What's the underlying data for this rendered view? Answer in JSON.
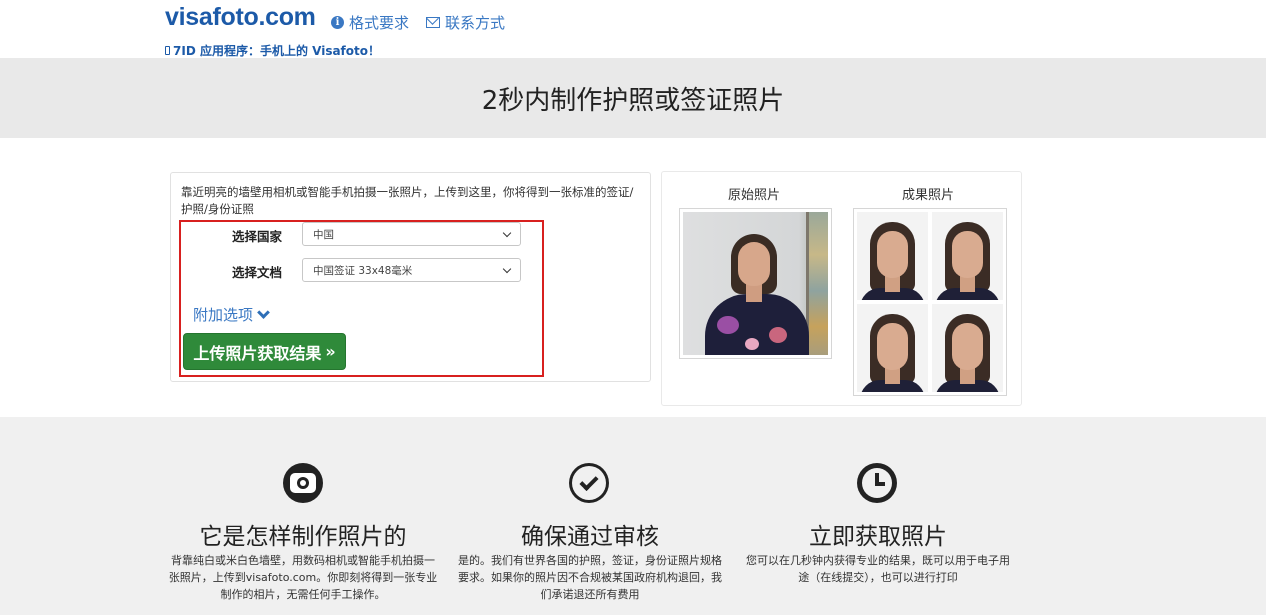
{
  "header": {
    "logo": "visafoto.com",
    "nav": [
      {
        "label": "格式要求",
        "icon": "info-icon"
      },
      {
        "label": "联系方式",
        "icon": "envelope-icon"
      }
    ],
    "app_promo": "7ID 应用程序：手机上的 Visafoto！"
  },
  "banner": {
    "title": "2秒内制作护照或签证照片"
  },
  "upload": {
    "intro": "靠近明亮的墙壁用相机或智能手机拍摄一张照片，上传到这里，你将得到一张标准的签证/护照/身份证照",
    "country_label": "选择国家",
    "country_value": "中国",
    "document_label": "选择文档",
    "document_value": "中国签证 33x48毫米",
    "options_label": "附加选项",
    "upload_button": "上传照片获取结果",
    "upload_button_suffix": "»"
  },
  "preview": {
    "original_title": "原始照片",
    "result_title": "成果照片"
  },
  "features": [
    {
      "icon": "camera-icon",
      "title": "它是怎样制作照片的",
      "text": "背靠纯白或米白色墙壁，用数码相机或智能手机拍摄一张照片，上传到visafoto.com。你即刻将得到一张专业制作的相片，无需任何手工操作。"
    },
    {
      "icon": "check-circle-icon",
      "title": "确保通过审核",
      "text": "是的。我们有世界各国的护照，签证，身份证照片规格要求。如果你的照片因不合规被某国政府机构退回，我们承诺退还所有费用"
    },
    {
      "icon": "clock-icon",
      "title": "立即获取照片",
      "text": "您可以在几秒钟内获得专业的结果，既可以用于电子用途（在线提交），也可以进行打印"
    }
  ]
}
